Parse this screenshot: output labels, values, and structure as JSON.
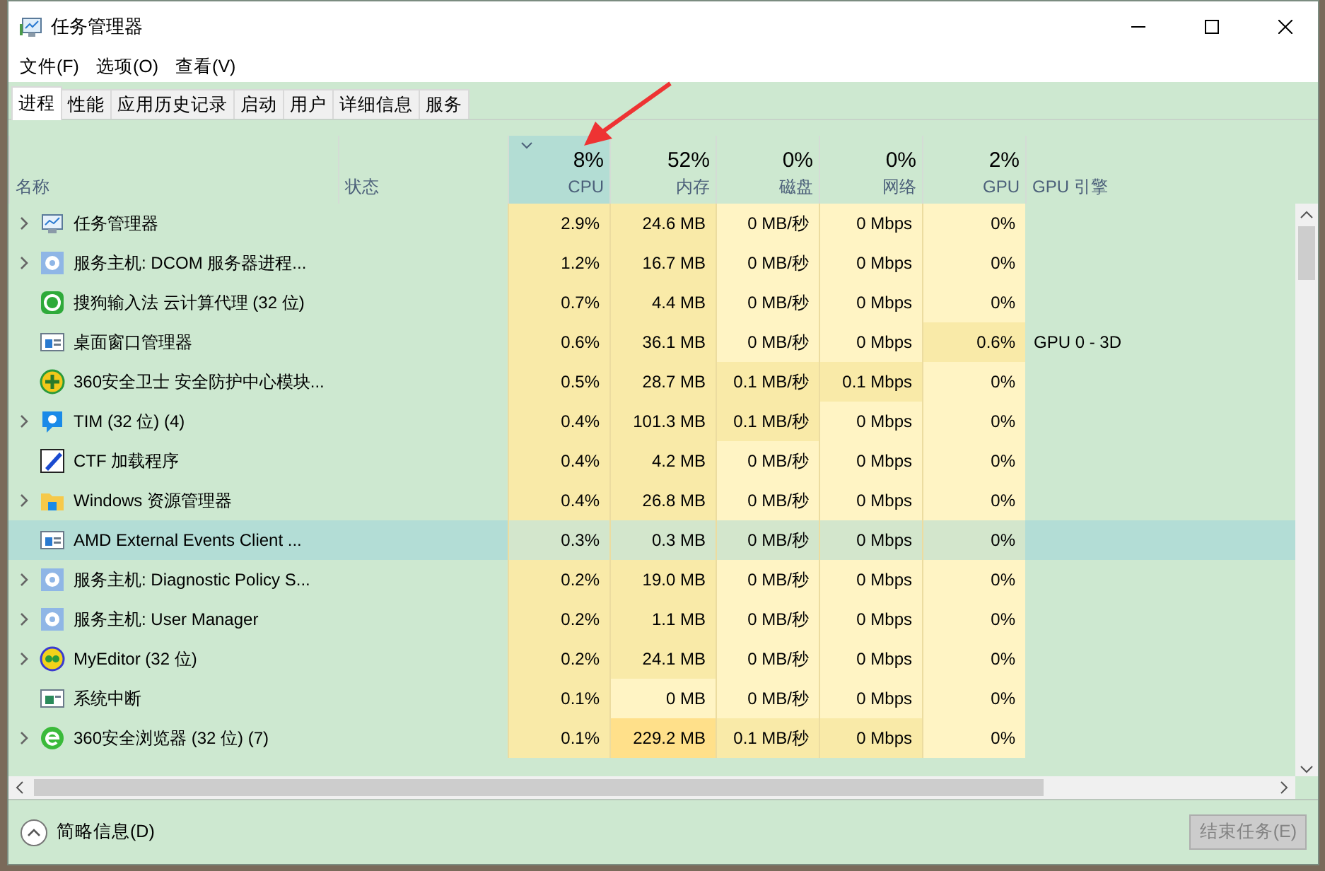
{
  "window": {
    "title": "任务管理器"
  },
  "menu": [
    "文件(F)",
    "选项(O)",
    "查看(V)"
  ],
  "tabs": [
    {
      "label": "进程",
      "selected": true
    },
    {
      "label": "性能",
      "selected": false
    },
    {
      "label": "应用历史记录",
      "selected": false
    },
    {
      "label": "启动",
      "selected": false
    },
    {
      "label": "用户",
      "selected": false
    },
    {
      "label": "详细信息",
      "selected": false
    },
    {
      "label": "服务",
      "selected": false
    }
  ],
  "columns": [
    {
      "name": "名称",
      "sorted": false
    },
    {
      "name": "状态",
      "sorted": false
    },
    {
      "percent": "8%",
      "name": "CPU",
      "sorted": true
    },
    {
      "percent": "52%",
      "name": "内存",
      "sorted": false
    },
    {
      "percent": "0%",
      "name": "磁盘",
      "sorted": false
    },
    {
      "percent": "0%",
      "name": "网络",
      "sorted": false
    },
    {
      "percent": "2%",
      "name": "GPU",
      "sorted": false
    },
    {
      "name": "GPU 引擎",
      "sorted": false
    }
  ],
  "rows": [
    {
      "name": "任务管理器",
      "expandable": true,
      "selected": false,
      "cells": [
        {
          "text": "2.9%",
          "color": "#f9eaa8"
        },
        {
          "text": "24.6 MB",
          "color": "#f9eaa8"
        },
        {
          "text": "0 MB/秒",
          "color": "#fff4c4"
        },
        {
          "text": "0 Mbps",
          "color": "#fff4c4"
        },
        {
          "text": "0%",
          "color": "#fff4c4"
        }
      ]
    },
    {
      "name": "服务主机: DCOM 服务器进程...",
      "expandable": true,
      "selected": false,
      "cells": [
        {
          "text": "1.2%",
          "color": "#f9eaa8"
        },
        {
          "text": "16.7 MB",
          "color": "#f9eaa8"
        },
        {
          "text": "0 MB/秒",
          "color": "#fff4c4"
        },
        {
          "text": "0 Mbps",
          "color": "#fff4c4"
        },
        {
          "text": "0%",
          "color": "#fff4c4"
        }
      ]
    },
    {
      "name": "搜狗输入法 云计算代理 (32 位)",
      "expandable": false,
      "selected": false,
      "cells": [
        {
          "text": "0.7%",
          "color": "#f9eaa8"
        },
        {
          "text": "4.4 MB",
          "color": "#f9eaa8"
        },
        {
          "text": "0 MB/秒",
          "color": "#fff4c4"
        },
        {
          "text": "0 Mbps",
          "color": "#fff4c4"
        },
        {
          "text": "0%",
          "color": "#fff4c4"
        }
      ]
    },
    {
      "name": "桌面窗口管理器",
      "expandable": false,
      "selected": false,
      "cells": [
        {
          "text": "0.6%",
          "color": "#f9eaa8"
        },
        {
          "text": "36.1 MB",
          "color": "#f9eaa8"
        },
        {
          "text": "0 MB/秒",
          "color": "#fff4c4"
        },
        {
          "text": "0 Mbps",
          "color": "#fff4c4"
        },
        {
          "text": "0.6%",
          "color": "#f9eaa8"
        }
      ],
      "gpu_engine": "GPU 0 - 3D"
    },
    {
      "name": "360安全卫士 安全防护中心模块...",
      "expandable": false,
      "selected": false,
      "cells": [
        {
          "text": "0.5%",
          "color": "#f9eaa8"
        },
        {
          "text": "28.7 MB",
          "color": "#f9eaa8"
        },
        {
          "text": "0.1 MB/秒",
          "color": "#f9eaa8"
        },
        {
          "text": "0.1 Mbps",
          "color": "#f9eaa8"
        },
        {
          "text": "0%",
          "color": "#fff4c4"
        }
      ]
    },
    {
      "name": "TIM (32 位) (4)",
      "expandable": true,
      "selected": false,
      "cells": [
        {
          "text": "0.4%",
          "color": "#f9eaa8"
        },
        {
          "text": "101.3 MB",
          "color": "#f9eaa8"
        },
        {
          "text": "0.1 MB/秒",
          "color": "#f9eaa8"
        },
        {
          "text": "0 Mbps",
          "color": "#fff4c4"
        },
        {
          "text": "0%",
          "color": "#fff4c4"
        }
      ]
    },
    {
      "name": "CTF 加载程序",
      "expandable": false,
      "selected": false,
      "cells": [
        {
          "text": "0.4%",
          "color": "#f9eaa8"
        },
        {
          "text": "4.2 MB",
          "color": "#f9eaa8"
        },
        {
          "text": "0 MB/秒",
          "color": "#fff4c4"
        },
        {
          "text": "0 Mbps",
          "color": "#fff4c4"
        },
        {
          "text": "0%",
          "color": "#fff4c4"
        }
      ]
    },
    {
      "name": "Windows 资源管理器",
      "expandable": true,
      "selected": false,
      "cells": [
        {
          "text": "0.4%",
          "color": "#f9eaa8"
        },
        {
          "text": "26.8 MB",
          "color": "#f9eaa8"
        },
        {
          "text": "0 MB/秒",
          "color": "#fff4c4"
        },
        {
          "text": "0 Mbps",
          "color": "#fff4c4"
        },
        {
          "text": "0%",
          "color": "#fff4c4"
        }
      ]
    },
    {
      "name": "AMD External Events Client ...",
      "expandable": false,
      "selected": true,
      "cells": [
        {
          "text": "0.3%",
          "color": "#d3e6cc"
        },
        {
          "text": "0.3 MB",
          "color": "#d3e6cc"
        },
        {
          "text": "0 MB/秒",
          "color": "#d3e6cc"
        },
        {
          "text": "0 Mbps",
          "color": "#d3e6cc"
        },
        {
          "text": "0%",
          "color": "#d3e6cc"
        }
      ]
    },
    {
      "name": "服务主机: Diagnostic Policy S...",
      "expandable": true,
      "selected": false,
      "cells": [
        {
          "text": "0.2%",
          "color": "#f9eaa8"
        },
        {
          "text": "19.0 MB",
          "color": "#f9eaa8"
        },
        {
          "text": "0 MB/秒",
          "color": "#fff4c4"
        },
        {
          "text": "0 Mbps",
          "color": "#fff4c4"
        },
        {
          "text": "0%",
          "color": "#fff4c4"
        }
      ]
    },
    {
      "name": "服务主机: User Manager",
      "expandable": true,
      "selected": false,
      "cells": [
        {
          "text": "0.2%",
          "color": "#f9eaa8"
        },
        {
          "text": "1.1 MB",
          "color": "#f9eaa8"
        },
        {
          "text": "0 MB/秒",
          "color": "#fff4c4"
        },
        {
          "text": "0 Mbps",
          "color": "#fff4c4"
        },
        {
          "text": "0%",
          "color": "#fff4c4"
        }
      ]
    },
    {
      "name": "MyEditor (32 位)",
      "expandable": true,
      "selected": false,
      "cells": [
        {
          "text": "0.2%",
          "color": "#f9eaa8"
        },
        {
          "text": "24.1 MB",
          "color": "#f9eaa8"
        },
        {
          "text": "0 MB/秒",
          "color": "#fff4c4"
        },
        {
          "text": "0 Mbps",
          "color": "#fff4c4"
        },
        {
          "text": "0%",
          "color": "#fff4c4"
        }
      ]
    },
    {
      "name": "系统中断",
      "expandable": false,
      "selected": false,
      "cells": [
        {
          "text": "0.1%",
          "color": "#f9eaa8"
        },
        {
          "text": "0 MB",
          "color": "#fff4c4"
        },
        {
          "text": "0 MB/秒",
          "color": "#fff4c4"
        },
        {
          "text": "0 Mbps",
          "color": "#fff4c4"
        },
        {
          "text": "0%",
          "color": "#fff4c4"
        }
      ]
    },
    {
      "name": "360安全浏览器 (32 位) (7)",
      "expandable": true,
      "selected": false,
      "cells": [
        {
          "text": "0.1%",
          "color": "#f9eaa8"
        },
        {
          "text": "229.2 MB",
          "color": "#ffe08a"
        },
        {
          "text": "0.1 MB/秒",
          "color": "#f9eaa8"
        },
        {
          "text": "0 Mbps",
          "color": "#f9eaa8"
        },
        {
          "text": "0%",
          "color": "#fff4c4"
        }
      ]
    }
  ],
  "footer": {
    "toggle": "简略信息(D)",
    "end_task": {
      "label": "结束任务(E)",
      "disabled": true
    }
  }
}
